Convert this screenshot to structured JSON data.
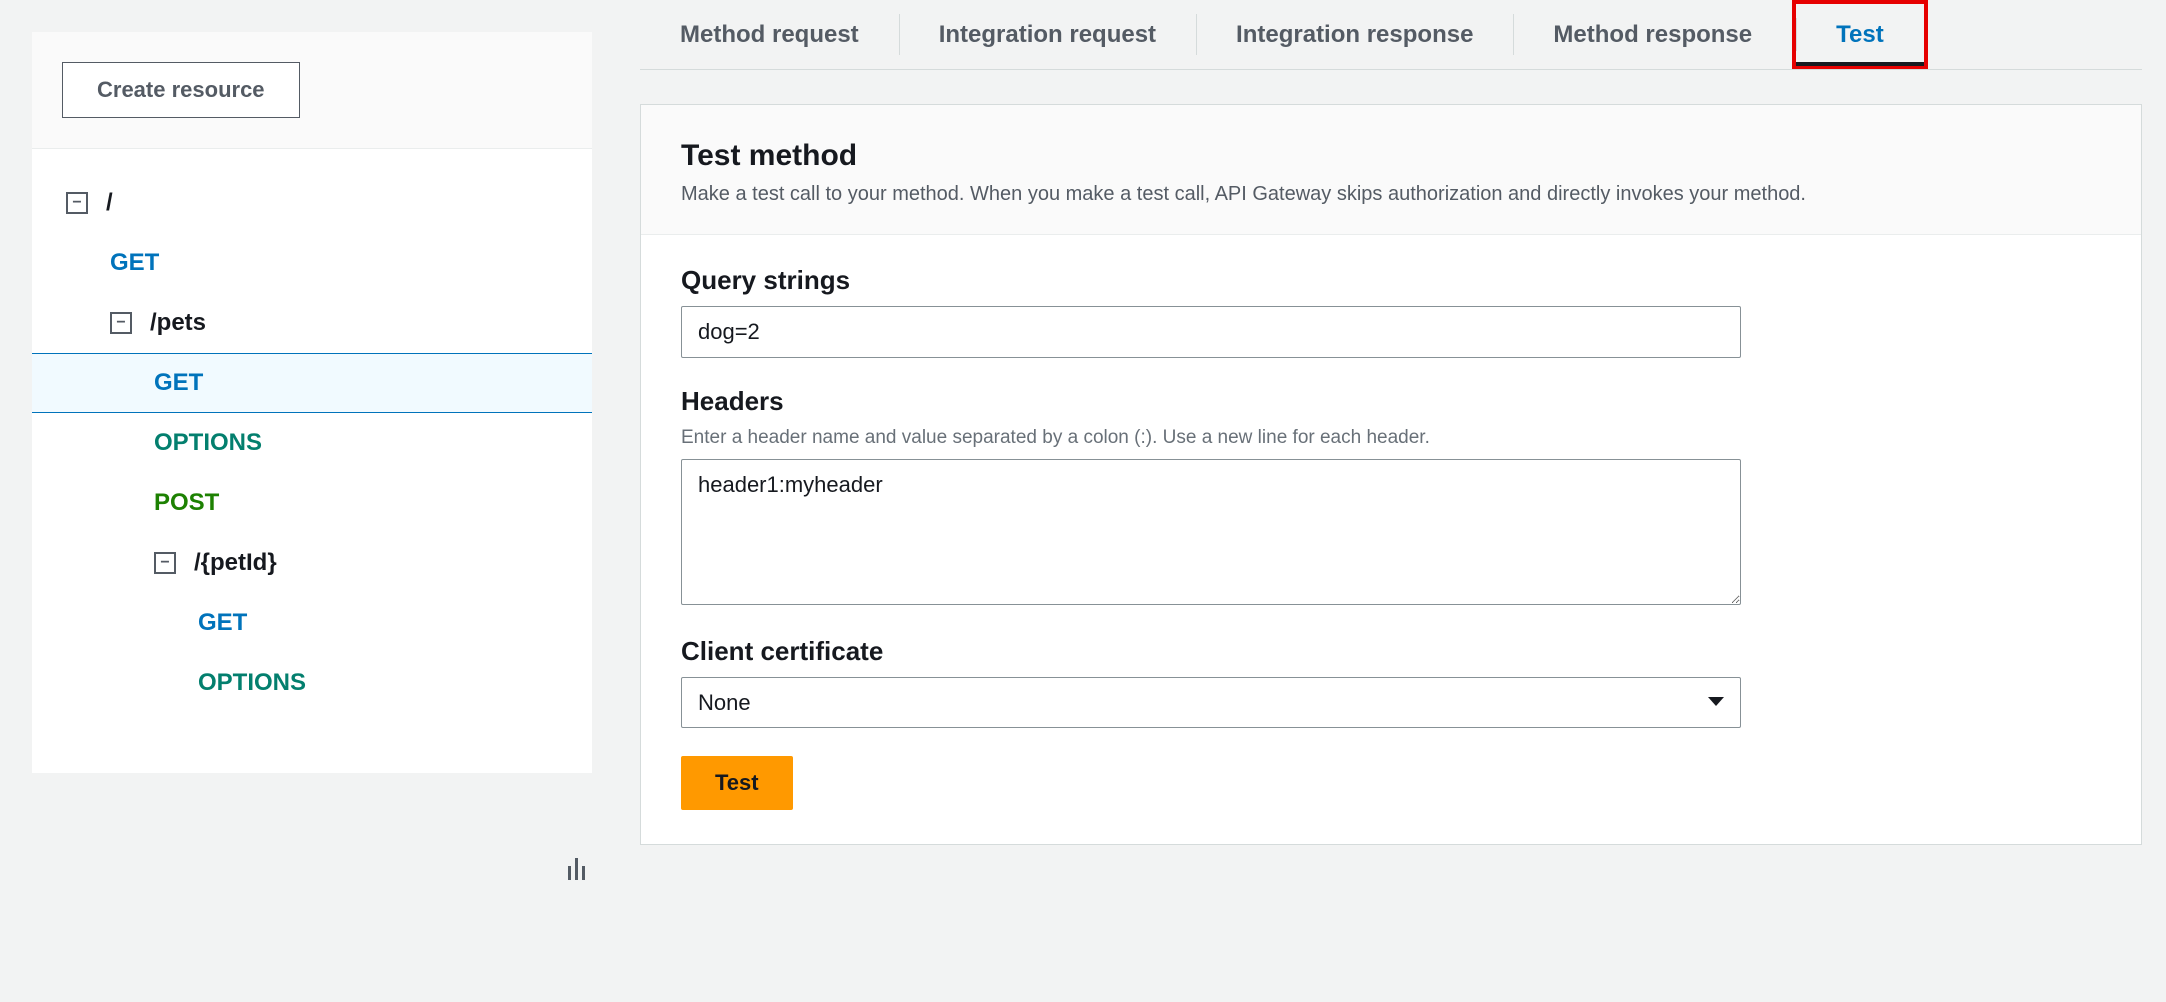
{
  "sidebar": {
    "create_label": "Create resource",
    "tree": {
      "root": "/",
      "root_get": "GET",
      "pets": "/pets",
      "pets_get": "GET",
      "pets_options": "OPTIONS",
      "pets_post": "POST",
      "petid": "/{petId}",
      "petid_get": "GET",
      "petid_options": "OPTIONS"
    }
  },
  "tabs": {
    "method_request": "Method request",
    "integration_request": "Integration request",
    "integration_response": "Integration response",
    "method_response": "Method response",
    "test": "Test"
  },
  "panel": {
    "title": "Test method",
    "description": "Make a test call to your method. When you make a test call, API Gateway skips authorization and directly invokes your method."
  },
  "form": {
    "query_strings_label": "Query strings",
    "query_strings_value": "dog=2",
    "headers_label": "Headers",
    "headers_hint": "Enter a header name and value separated by a colon (:). Use a new line for each header.",
    "headers_value": "header1:myheader",
    "client_cert_label": "Client certificate",
    "client_cert_value": "None",
    "test_button": "Test"
  }
}
